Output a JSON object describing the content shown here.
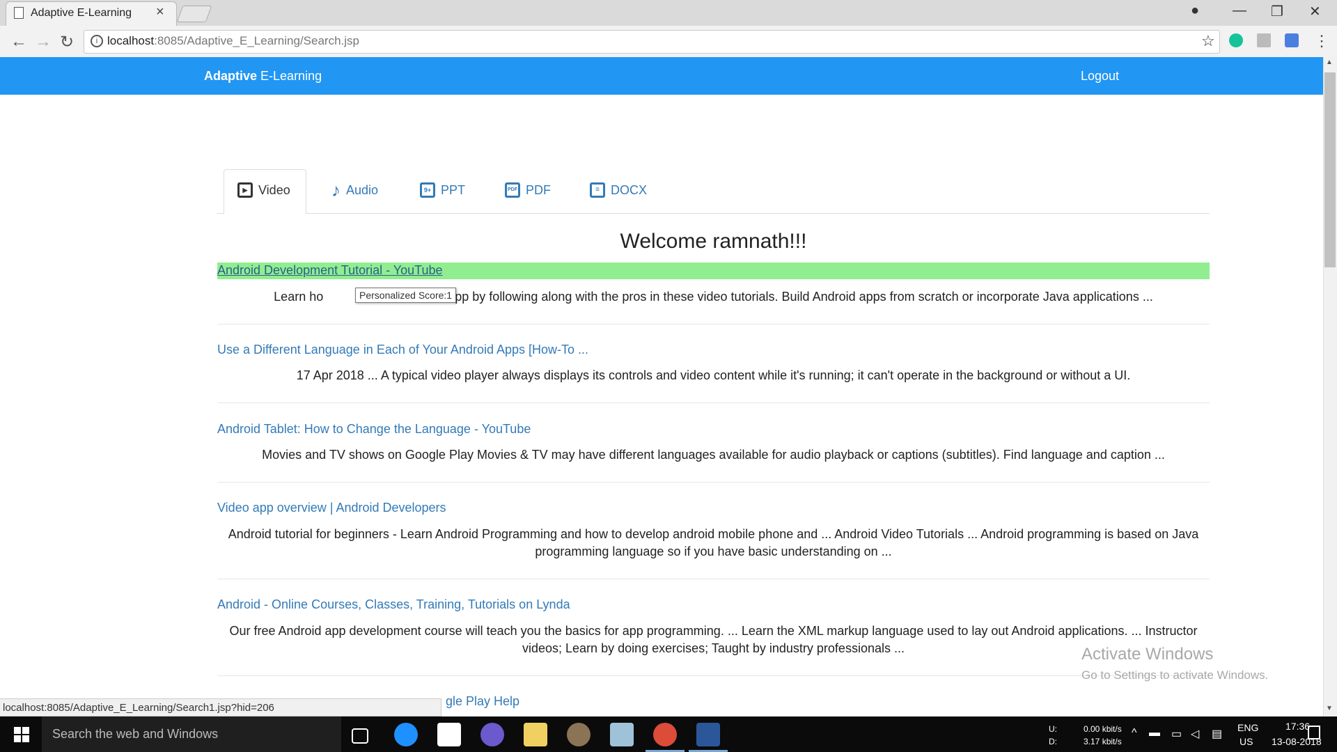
{
  "browser": {
    "tab_title": "Adaptive E-Learning",
    "tab_close": "×",
    "url_host": "localhost",
    "url_rest": ":8085/Adaptive_E_Learning/Search.jsp",
    "status_url": "localhost:8085/Adaptive_E_Learning/Search1.jsp?hid=206"
  },
  "navbar": {
    "brand_bold": "Adaptive",
    "brand_rest": " E-Learning",
    "logout": "Logout",
    "color": "#2196f3"
  },
  "tabs": [
    {
      "label": "Video",
      "icon": "tv-icon"
    },
    {
      "label": "Audio",
      "icon": "music-note-icon"
    },
    {
      "label": "PPT",
      "icon": "ppt-icon"
    },
    {
      "label": "PDF",
      "icon": "pdf-icon"
    },
    {
      "label": "DOCX",
      "icon": "document-icon"
    }
  ],
  "welcome": "Welcome ramnath!!!",
  "results": [
    {
      "title": "Android Development Tutorial - YouTube",
      "desc_a": "Learn ho",
      "desc_b": "oid app by following along with the pros in these video tutorials. Build Android apps from scratch or incorporate Java applications  ..."
    },
    {
      "title": "Use a Different Language in Each of Your Android Apps [How-To ...",
      "desc": "17 Apr 2018 ... A typical video player always displays its controls and video content while it's running; it can't operate in the background or without a UI."
    },
    {
      "title": "Android Tablet: How to Change the Language - YouTube",
      "desc": "Movies and TV shows on Google Play Movies & TV may have different languages available for audio playback or captions (subtitles). Find language and caption ..."
    },
    {
      "title": "Video app overview | Android Developers",
      "desc": "Android tutorial for beginners - Learn Android Programming and how to develop android mobile phone and ... Android Video Tutorials ... Android programming is based on Java programming language so if you have basic understanding on ..."
    },
    {
      "title": "Android - Online Courses, Classes, Training, Tutorials on Lynda",
      "desc": "Our free Android app development course will teach you the basics for app programming. ... Learn the XML markup language used to lay out Android applications. ... Instructor videos; Learn by doing exercises; Taught by industry professionals ..."
    },
    {
      "title": "gle Play Help"
    }
  ],
  "tooltip": "Personalized Score:1",
  "highlight_color": "#90ee90",
  "watermark": {
    "title": "Activate Windows",
    "subtitle": "Go to Settings to activate Windows."
  },
  "taskbar": {
    "search_placeholder": "Search the web and Windows",
    "net_up_label": "U:",
    "net_down_label": "D:",
    "net_up_value": "0.00 kbit/s",
    "net_down_value": "3.17 kbit/s",
    "lang1": "ENG",
    "lang2": "US",
    "time": "17:36",
    "date": "13-08-2018"
  }
}
